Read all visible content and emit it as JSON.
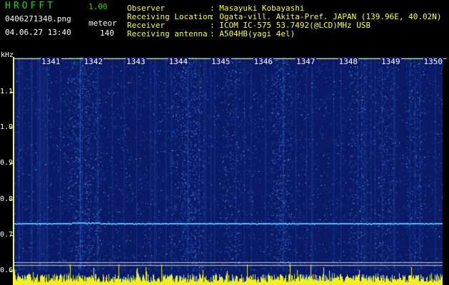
{
  "header": {
    "app_name": "HROFFT",
    "version": "1.00",
    "filename": "0406271340.png",
    "datetime": "04.06.27 13:40",
    "meteor_label": "meteor",
    "meteor_count": "140",
    "fields": [
      {
        "label": "Observer",
        "value": ": Masayuki Kobayashi"
      },
      {
        "label": "Receiving Location",
        "value": ": Ogata-vill. Akita-Pref. JAPAN (139.96E, 40.02N)"
      },
      {
        "label": "Receiver",
        "value": ": ICOM IC-575 53.7492(@LCD)MHz USB"
      },
      {
        "label": "Receiving antenna",
        "value": ": A504HB(yagi 4el)"
      }
    ]
  },
  "spectrogram": {
    "unit_label": "kHz",
    "y_ticks": [
      "1.1",
      "1.0",
      "0.9",
      "0.8",
      "0.7",
      "0.6"
    ],
    "x_ticks": [
      "1341",
      "1342",
      "1343",
      "1344",
      "1345",
      "1346",
      "1347",
      "1348",
      "1349",
      "1350"
    ],
    "colors": {
      "background": "#0a1a66",
      "signal": "#5ab8ff",
      "axis": "#ffff33"
    }
  }
}
